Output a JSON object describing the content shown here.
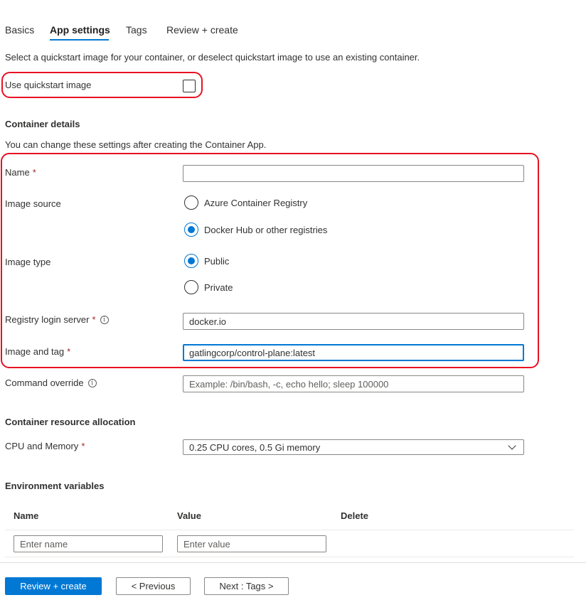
{
  "tabs": [
    {
      "label": "Basics"
    },
    {
      "label": "App settings",
      "active": true
    },
    {
      "label": "Tags"
    },
    {
      "label": "Review + create"
    }
  ],
  "intro_text": "Select a quickstart image for your container, or deselect quickstart image to use an existing container.",
  "quickstart": {
    "label": "Use quickstart image",
    "checked": false
  },
  "container_details": {
    "heading": "Container details",
    "description": "You can change these settings after creating the Container App.",
    "name": {
      "label": "Name",
      "required_mark": "*",
      "value": ""
    },
    "image_source": {
      "label": "Image source",
      "options": [
        "Azure Container Registry",
        "Docker Hub or other registries"
      ],
      "selected": "Docker Hub or other registries"
    },
    "image_type": {
      "label": "Image type",
      "options": [
        "Public",
        "Private"
      ],
      "selected": "Public"
    },
    "registry_login_server": {
      "label": "Registry login server",
      "required_mark": "*",
      "value": "docker.io"
    },
    "image_and_tag": {
      "label": "Image and tag",
      "required_mark": "*",
      "value": "gatlingcorp/control-plane:latest"
    },
    "command_override": {
      "label": "Command override",
      "placeholder": "Example: /bin/bash, -c, echo hello; sleep 100000"
    }
  },
  "resources": {
    "heading": "Container resource allocation",
    "cpu_memory": {
      "label": "CPU and Memory",
      "required_mark": "*",
      "value": "0.25 CPU cores, 0.5 Gi memory"
    }
  },
  "env_vars": {
    "heading": "Environment variables",
    "columns": [
      "Name",
      "Value",
      "Delete"
    ],
    "name_placeholder": "Enter name",
    "value_placeholder": "Enter value"
  },
  "footer": {
    "review_create": "Review + create",
    "previous": "< Previous",
    "next": "Next : Tags >"
  },
  "colors": {
    "accent": "#0078d4",
    "highlight": "#e81123",
    "required": "#a4262c"
  }
}
